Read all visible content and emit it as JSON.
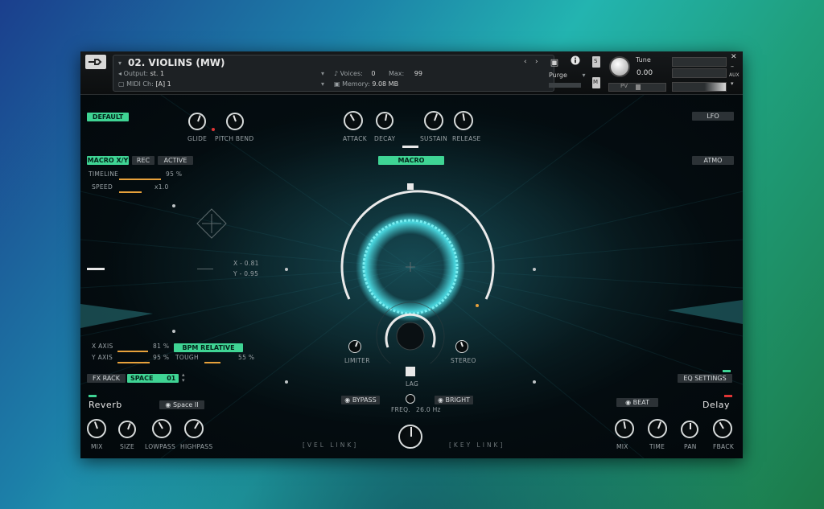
{
  "header": {
    "instrument_name": "02. VIOLINS (MW)",
    "output_label": "Output:",
    "output_value": "st. 1",
    "midi_label": "MIDI Ch:",
    "midi_value": "[A]  1",
    "voices_label": "Voices:",
    "voices_value": "0",
    "max_label": "Max:",
    "max_value": "99",
    "memory_label": "Memory:",
    "memory_value": "9.08 MB",
    "purge_label": "Purge",
    "tune_label": "Tune",
    "tune_value": "0.00",
    "side_labels": [
      "S",
      "M"
    ],
    "aux_label": "AUX",
    "pv_label": "PV"
  },
  "top_controls": {
    "default_button": "DEFAULT",
    "lfo_button": "LFO",
    "atmo_button": "ATMO",
    "macro_button": "MACRO",
    "knobs": [
      {
        "label": "GLIDE"
      },
      {
        "label": "PITCH BEND"
      },
      {
        "label": "ATTACK"
      },
      {
        "label": "DECAY"
      },
      {
        "label": "SUSTAIN"
      },
      {
        "label": "RELEASE"
      }
    ]
  },
  "macro_xy": {
    "macro_xy_button": "MACRO X/Y",
    "rec_button": "REC",
    "active_button": "ACTIVE",
    "timeline_label": "TIMELINE",
    "timeline_value": "95 %",
    "speed_label": "SPEED",
    "speed_value": "x1.0",
    "x_readout": "X - 0.81",
    "y_readout": "Y - 0.95"
  },
  "axes": {
    "x_axis_label": "X AXIS",
    "x_axis_value": "81 %",
    "y_axis_label": "Y AXIS",
    "y_axis_value": "95 %",
    "bpm_relative_button": "BPM RELATIVE",
    "tough_label": "TOUGH",
    "tough_value": "55 %"
  },
  "center": {
    "limiter_label": "LIMITER",
    "stereo_label": "STEREO",
    "lag_label": "LAG",
    "freq_label": "FREQ.",
    "freq_value": "26.0 Hz",
    "bypass_button": "BYPASS",
    "bright_button": "BRIGHT",
    "vel_link": "[VEL LINK]",
    "key_link": "[KEY LINK]"
  },
  "fx": {
    "fx_rack_button": "FX RACK",
    "space_label": "SPACE",
    "space_value": "01",
    "eq_settings_button": "EQ SETTINGS",
    "reverb_title": "Reverb",
    "reverb_preset": "Space II",
    "reverb_knobs": [
      "MIX",
      "SIZE",
      "LOWPASS",
      "HIGHPASS"
    ],
    "delay_title": "Delay",
    "delay_sync_button": "BEAT",
    "delay_knobs": [
      "MIX",
      "TIME",
      "PAN",
      "FBACK"
    ]
  },
  "colors": {
    "accent_green": "#3fd494",
    "orange": "#e7a13b",
    "ring_cyan": "#4fe6ee",
    "red_indicator": "#e03535"
  },
  "levels": {
    "timeline_fraction": 0.95,
    "speed_fraction": 0.5,
    "x_axis_fraction": 0.81,
    "y_axis_fraction": 0.95,
    "tough_fraction": 0.55
  }
}
